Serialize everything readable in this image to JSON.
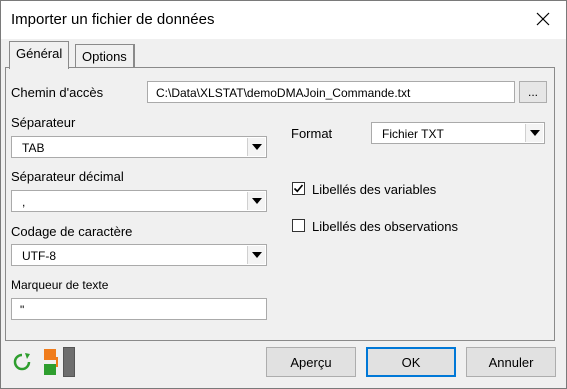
{
  "window": {
    "title": "Importer un fichier de données"
  },
  "tabs": [
    {
      "label": "Général",
      "active": true
    },
    {
      "label": "Options",
      "active": false
    }
  ],
  "path": {
    "label": "Chemin d'accès",
    "value": "C:\\Data\\XLSTAT\\demoDMAJoin_Commande.txt",
    "browse_label": "..."
  },
  "separator": {
    "label": "Séparateur",
    "value": "TAB"
  },
  "decimal_separator": {
    "label": "Séparateur décimal",
    "value": ","
  },
  "encoding": {
    "label": "Codage de caractère",
    "value": "UTF-8"
  },
  "text_marker": {
    "label": "Marqueur de texte",
    "value": "\""
  },
  "format": {
    "label": "Format",
    "value": "Fichier TXT"
  },
  "options": [
    {
      "label": "Libellés des variables",
      "checked": true
    },
    {
      "label": "Libellés des observations",
      "checked": false
    }
  ],
  "buttons": {
    "preview": "Aperçu",
    "ok": "OK",
    "cancel": "Annuler"
  },
  "colors": {
    "accent": "#0078d7",
    "reset_icon": "#2e9e2e",
    "orange": "#f07c1b",
    "green": "#2e9e2e"
  },
  "icons": [
    "close-icon",
    "reset-icon",
    "swap-icon",
    "chevron-down-icon",
    "check-icon"
  ]
}
